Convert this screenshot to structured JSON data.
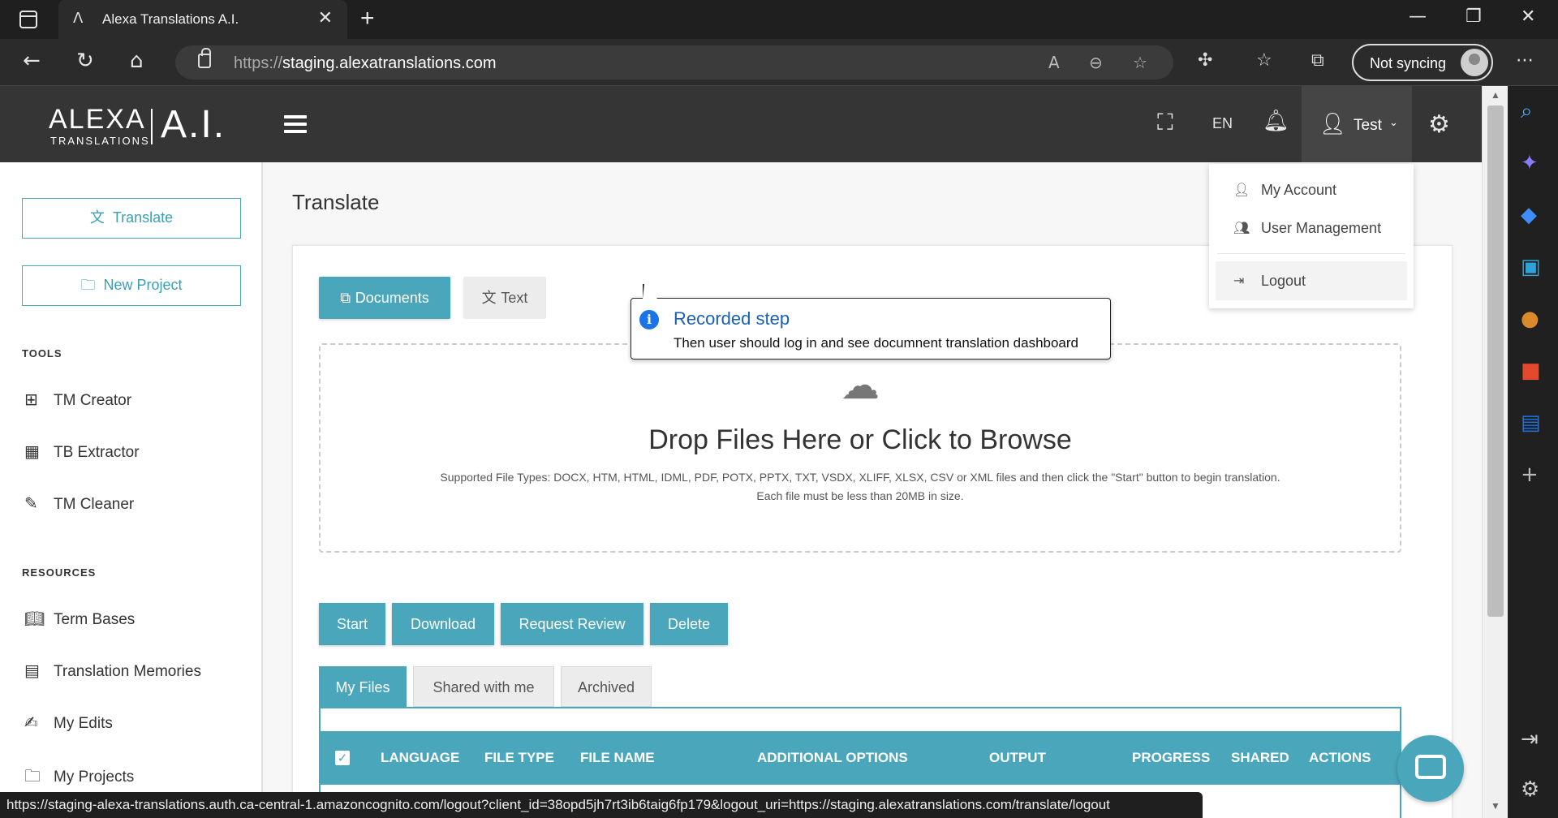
{
  "browser": {
    "tab_title": "Alexa Translations A.I.",
    "url_scheme": "https://",
    "url_host": "staging.alexatranslations.com",
    "sync_label": "Not syncing"
  },
  "app": {
    "logo_text": "ALEXA",
    "logo_sub": "TRANSLATIONS",
    "logo_ai": "A.I.",
    "lang": "EN",
    "user": "Test"
  },
  "user_menu": {
    "items": [
      "My Account",
      "User Management",
      "Logout"
    ]
  },
  "sidebar": {
    "translate_button": "Translate",
    "new_project_button": "New Project",
    "tools_heading": "TOOLS",
    "tools": [
      "TM Creator",
      "TB Extractor",
      "TM Cleaner"
    ],
    "resources_heading": "RESOURCES",
    "resources": [
      "Term Bases",
      "Translation Memories",
      "My Edits",
      "My Projects"
    ]
  },
  "main": {
    "title": "Translate",
    "mode_tabs": [
      "Documents",
      "Text"
    ],
    "drop_title": "Drop Files Here or Click to Browse",
    "drop_line1": "Supported File Types: DOCX, HTM, HTML, IDML, PDF, POTX, PPTX, TXT, VSDX, XLIFF, XLSX, CSV or XML files and then click the \"Start\" button to begin translation.",
    "drop_line2": "Each file must be less than 20MB in size.",
    "actions": [
      "Start",
      "Download",
      "Request Review",
      "Delete"
    ],
    "file_tabs": [
      "My Files",
      "Shared with me",
      "Archived"
    ],
    "columns": [
      "LANGUAGE",
      "FILE TYPE",
      "FILE NAME",
      "ADDITIONAL OPTIONS",
      "OUTPUT",
      "PROGRESS",
      "SHARED",
      "ACTIONS"
    ]
  },
  "callout": {
    "title": "Recorded step",
    "text": "Then user should log in and see documnent translation dashboard"
  },
  "status_url": "https://staging-alexa-translations.auth.ca-central-1.amazoncognito.com/logout?client_id=38opd5jh7rt3ib6taig6fp179&logout_uri=https://staging.alexatranslations.com/translate/logout"
}
